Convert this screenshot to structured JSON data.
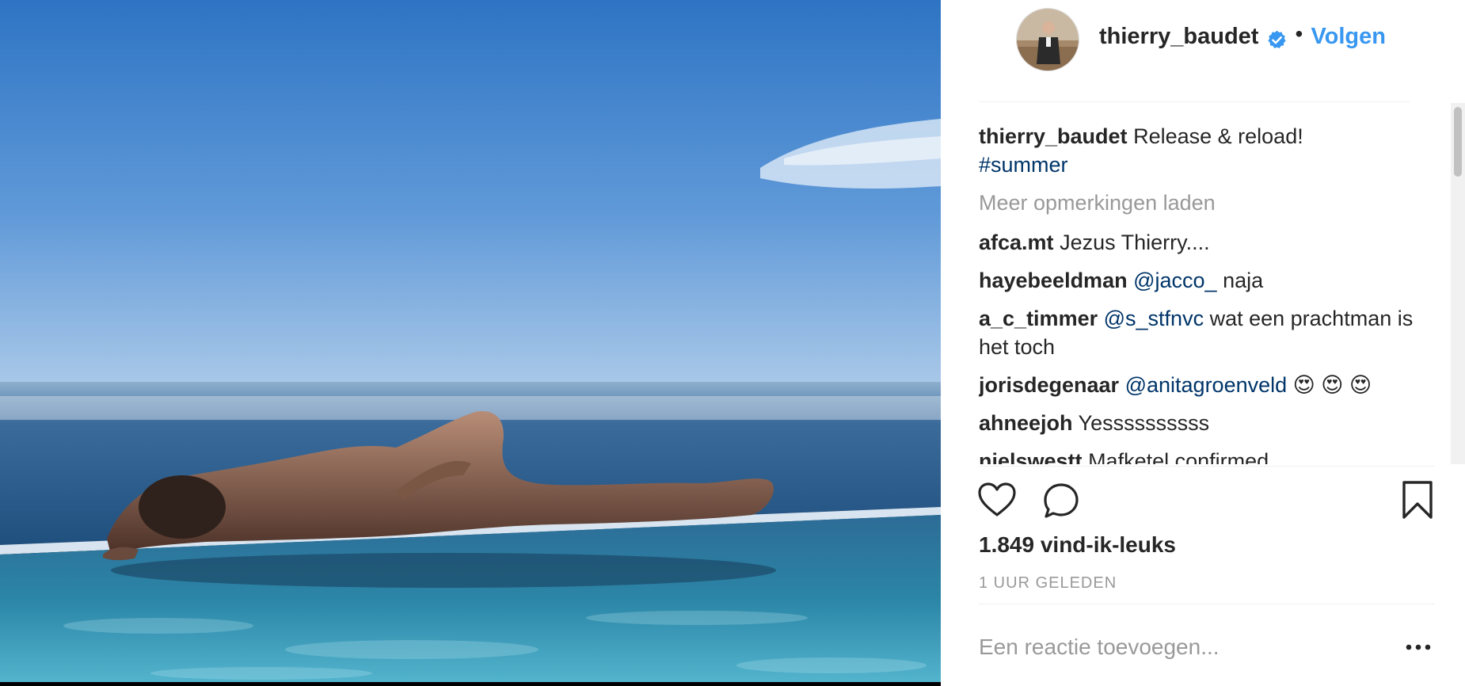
{
  "post": {
    "username": "thierry_baudet",
    "follow_label": "Volgen",
    "separator": "•",
    "caption_user": "thierry_baudet",
    "caption_text": "Release & reload!",
    "caption_hashtag": "#summer",
    "load_more": "Meer opmerkingen laden",
    "likes": "1.849 vind-ik-leuks",
    "time": "1 UUR GELEDEN",
    "comment_placeholder": "Een reactie toevoegen..."
  },
  "comments": [
    {
      "user": "afca.mt",
      "mention": "",
      "text": "Jezus Thierry...."
    },
    {
      "user": "hayebeeldman",
      "mention": "@jacco_",
      "text": "naja"
    },
    {
      "user": "a_c_timmer",
      "mention": "@s_stfnvc",
      "text": "wat een prachtman is het toch"
    },
    {
      "user": "jorisdegenaar",
      "mention": "@anitagroenveld",
      "text": "😍 😍 😍"
    },
    {
      "user": "ahneejoh",
      "mention": "",
      "text": "Yessssssssss"
    },
    {
      "user": "nielswestt",
      "mention": "",
      "text": "Mafketel confirmed"
    }
  ],
  "icons": {
    "verified": "verified-badge-icon",
    "like": "heart-icon",
    "comment": "comment-bubble-icon",
    "save": "bookmark-icon",
    "more": "more-options-icon"
  },
  "colors": {
    "link": "#3897f0",
    "mention": "#003569",
    "muted": "#999999",
    "text": "#262626"
  }
}
